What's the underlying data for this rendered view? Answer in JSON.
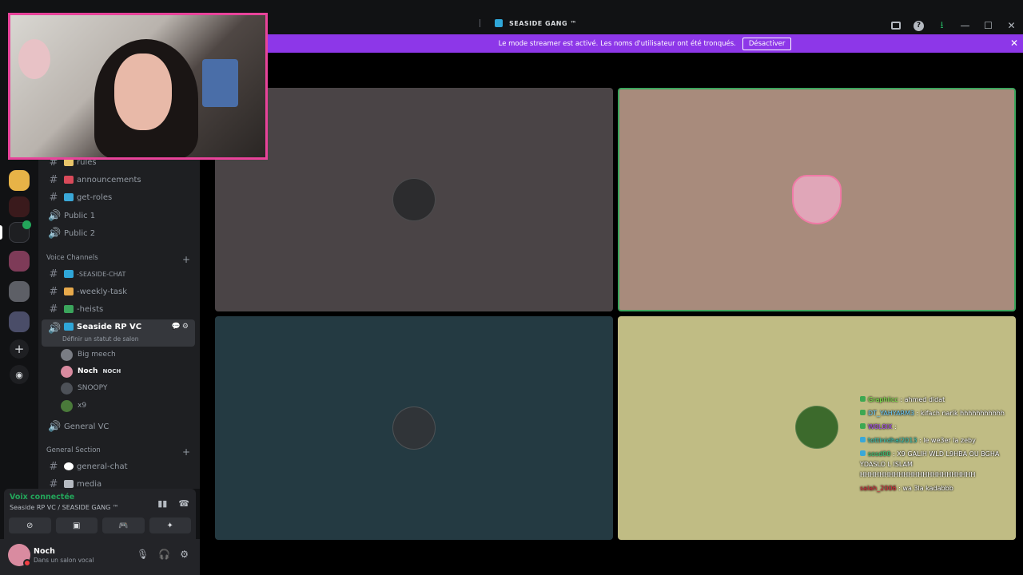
{
  "window": {
    "server_title": "SEASIDE GANG ™"
  },
  "banner": {
    "text": "Le mode streamer est activé. Les noms d'utilisateur ont été tronqués.",
    "button": "Désactiver"
  },
  "channels": {
    "items": [
      {
        "name": "rules",
        "icon": "hash-icon"
      },
      {
        "name": "announcements",
        "icon": "hash-icon"
      },
      {
        "name": "get-roles",
        "icon": "hash-icon"
      },
      {
        "name": "Public 1",
        "icon": "speaker-icon"
      },
      {
        "name": "Public 2",
        "icon": "speaker-icon"
      }
    ],
    "voice_category": "Voice Channels",
    "voice_items": [
      {
        "name": "-SEASIDE-CHAT"
      },
      {
        "name": "-weekly-task"
      },
      {
        "name": "-heists"
      }
    ],
    "active_channel": "Seaside RP VC",
    "active_status": "Définir un statut de salon",
    "voice_users": [
      {
        "name": "Big meech"
      },
      {
        "name": "Noch",
        "tag": "NOCH"
      },
      {
        "name": "SNOOPY"
      },
      {
        "name": "x9"
      }
    ],
    "general_vc": "General VC",
    "general_category": "General Section",
    "general_items": [
      {
        "name": "general-chat"
      },
      {
        "name": "media"
      }
    ]
  },
  "voice_panel": {
    "status": "Voix connectée",
    "channel_path": "Seaside RP VC / ",
    "server": "SEASIDE GANG ™"
  },
  "user": {
    "name": "Noch",
    "status": "Dans un salon vocal"
  },
  "chat_overlay": [
    {
      "user": "Graphiicc",
      "msg": ": ahmed didat",
      "cls": "u1"
    },
    {
      "user": "DT_YAHYARM3",
      "msg": ": kifach narik hhhhhhhhhhh",
      "cls": "u2"
    },
    {
      "user": "W0L0IX",
      "msg": ":",
      "cls": "u3"
    },
    {
      "user": "tottinidhal2013",
      "msg": ": le we3er la zeby",
      "cls": "u4"
    },
    {
      "user": "sosd00",
      "msg": ": X9 GALIH WLD L9HBA OU BGHA YDASLO L ISLAM HHHHHHHHHHHHHHHHHHHHHHHH",
      "cls": "u5"
    },
    {
      "user": "salah_2006",
      "msg": ": wa 3la kadabbb",
      "cls": "u6"
    }
  ]
}
